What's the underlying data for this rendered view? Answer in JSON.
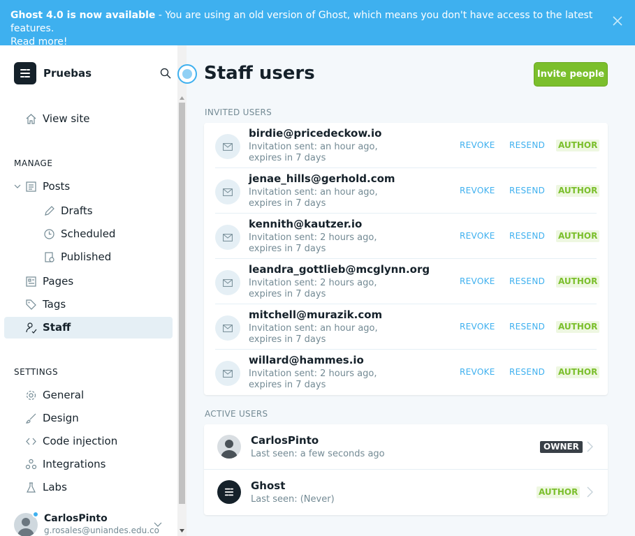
{
  "banner": {
    "headline": "Ghost 4.0 is now available",
    "message": " - You are using an old version of Ghost, which means you don't have access to the latest features.",
    "link": "Read more!"
  },
  "sidebar": {
    "site_name": "Pruebas",
    "view_site": "View site",
    "manage_title": "MANAGE",
    "posts": "Posts",
    "drafts": "Drafts",
    "scheduled": "Scheduled",
    "published": "Published",
    "pages": "Pages",
    "tags": "Tags",
    "staff": "Staff",
    "settings_title": "SETTINGS",
    "general": "General",
    "design": "Design",
    "code_injection": "Code injection",
    "integrations": "Integrations",
    "labs": "Labs",
    "user_name": "CarlosPinto",
    "user_email": "g.rosales@uniandes.edu.co"
  },
  "main": {
    "title": "Staff users",
    "invite_button": "Invite people",
    "invited_label": "INVITED USERS",
    "active_label": "ACTIVE USERS",
    "revoke": "REVOKE",
    "resend": "RESEND",
    "invited": [
      {
        "email": "birdie@pricedeckow.io",
        "status": "Invitation sent: an hour ago, expires in 7 days",
        "role": "AUTHOR"
      },
      {
        "email": "jenae_hills@gerhold.com",
        "status": "Invitation sent: an hour ago, expires in 7 days",
        "role": "AUTHOR"
      },
      {
        "email": "kennith@kautzer.io",
        "status": "Invitation sent: 2 hours ago, expires in 7 days",
        "role": "AUTHOR"
      },
      {
        "email": "leandra_gottlieb@mcglynn.org",
        "status": "Invitation sent: 2 hours ago, expires in 7 days",
        "role": "AUTHOR"
      },
      {
        "email": "mitchell@murazik.com",
        "status": "Invitation sent: an hour ago, expires in 7 days",
        "role": "AUTHOR"
      },
      {
        "email": "willard@hammes.io",
        "status": "Invitation sent: 2 hours ago, expires in 7 days",
        "role": "AUTHOR"
      }
    ],
    "active": [
      {
        "name": "CarlosPinto",
        "status": "Last seen: a few seconds ago",
        "role": "OWNER"
      },
      {
        "name": "Ghost",
        "status": "Last seen: (Never)",
        "role": "AUTHOR"
      }
    ]
  },
  "colors": {
    "accent": "#3eb0ef",
    "green": "#7bbf2c",
    "dark": "#15212a"
  }
}
